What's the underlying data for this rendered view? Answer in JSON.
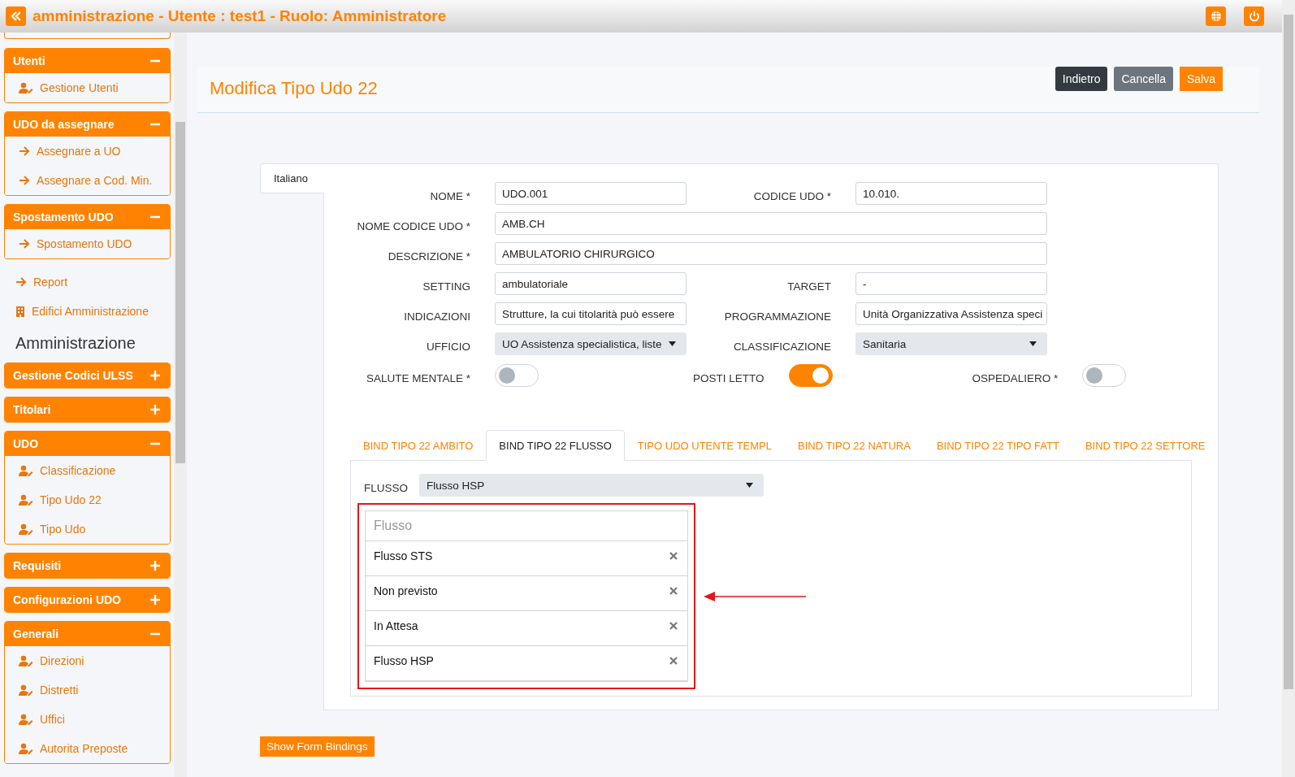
{
  "header": {
    "title": "amministrazione - Utente : test1 - Ruolo: Amministratore"
  },
  "sidebar": {
    "sections": [
      {
        "kind": "panel",
        "title": "Utenti",
        "expanded": true,
        "items": [
          {
            "label": "Gestione Utenti",
            "kind": "user"
          }
        ]
      },
      {
        "kind": "panel",
        "title": "UDO da assegnare",
        "expanded": true,
        "items": [
          {
            "label": "Assegnare a UO",
            "kind": "arrow"
          },
          {
            "label": "Assegnare a Cod. Min.",
            "kind": "arrow"
          }
        ]
      },
      {
        "kind": "panel",
        "title": "Spostamento UDO",
        "expanded": true,
        "items": [
          {
            "label": "Spostamento UDO",
            "kind": "arrow"
          }
        ]
      },
      {
        "kind": "arrow-link",
        "label": "Report"
      },
      {
        "kind": "building-link",
        "label": "Edifici Amministrazione"
      },
      {
        "kind": "heading",
        "label": "Amministrazione"
      },
      {
        "kind": "panel",
        "title": "Gestione Codici ULSS",
        "expanded": false
      },
      {
        "kind": "panel",
        "title": "Titolari",
        "expanded": false
      },
      {
        "kind": "panel",
        "title": "UDO",
        "expanded": true,
        "items": [
          {
            "label": "Classificazione",
            "kind": "user"
          },
          {
            "label": "Tipo Udo 22",
            "kind": "user"
          },
          {
            "label": "Tipo Udo",
            "kind": "user"
          }
        ]
      },
      {
        "kind": "panel",
        "title": "Requisiti",
        "expanded": false
      },
      {
        "kind": "panel",
        "title": "Configurazioni UDO",
        "expanded": false
      },
      {
        "kind": "panel",
        "title": "Generali",
        "expanded": true,
        "items": [
          {
            "label": "Direzioni",
            "kind": "user"
          },
          {
            "label": "Distretti",
            "kind": "user"
          },
          {
            "label": "Uffici",
            "kind": "user"
          },
          {
            "label": "Autorita Preposte",
            "kind": "user"
          }
        ]
      }
    ]
  },
  "page": {
    "title": "Modifica Tipo Udo 22",
    "buttons": [
      {
        "label": "Indietro",
        "kind": "dark"
      },
      {
        "label": "Cancella",
        "kind": "secondary"
      },
      {
        "label": "Salva",
        "kind": "primary"
      }
    ]
  },
  "form": {
    "language_tabs": [
      {
        "label": "Italiano",
        "selected": true
      }
    ],
    "rows": [
      [
        {
          "label": "NOME *",
          "kind": "text",
          "value": "UDO.001"
        },
        {
          "label": "CODICE UDO *",
          "kind": "text",
          "value": "10.010."
        }
      ],
      [
        {
          "label": "NOME CODICE UDO *",
          "kind": "text",
          "value": "AMB.CH"
        }
      ],
      [
        {
          "label": "DESCRIZIONE *",
          "kind": "text",
          "value": "AMBULATORIO CHIRURGICO"
        }
      ],
      [
        {
          "label": "SETTING",
          "kind": "text",
          "value": "ambulatoriale"
        },
        {
          "label": "TARGET",
          "kind": "text",
          "value": "-"
        }
      ],
      [
        {
          "label": "INDICAZIONI",
          "kind": "text",
          "value": "Strutture, la cui titolarità può essere"
        },
        {
          "label": "PROGRAMMAZIONE",
          "kind": "text",
          "value": "Unità Organizzativa Assistenza speci"
        }
      ],
      [
        {
          "label": "UFFICIO",
          "kind": "select",
          "value": "UO Assistenza specialistica, liste"
        },
        {
          "label": "CLASSIFICAZIONE",
          "kind": "select",
          "value": "Sanitaria"
        }
      ]
    ],
    "toggles": [
      {
        "label": "SALUTE MENTALE *",
        "on": false
      },
      {
        "label": "POSTI LETTO",
        "on": true
      },
      {
        "label": "OSPEDALIERO *",
        "on": false
      }
    ]
  },
  "bindings": {
    "tabs": [
      {
        "label": "BIND TIPO 22 AMBITO",
        "selected": false
      },
      {
        "label": "BIND TIPO 22 FLUSSO",
        "selected": true
      },
      {
        "label": "TIPO UDO UTENTE TEMPL",
        "selected": false
      },
      {
        "label": "BIND TIPO 22 NATURA",
        "selected": false
      },
      {
        "label": "BIND TIPO 22 TIPO FATT",
        "selected": false
      },
      {
        "label": "BIND TIPO 22 SETTORE",
        "selected": false
      }
    ],
    "select": {
      "label": "FLUSSO",
      "value": "Flusso HSP"
    },
    "list": {
      "placeholder": "Flusso",
      "items": [
        "Flusso STS",
        "Non previsto",
        "In Attesa",
        "Flusso HSP"
      ]
    }
  },
  "footer_button": "Show Form Bindings"
}
